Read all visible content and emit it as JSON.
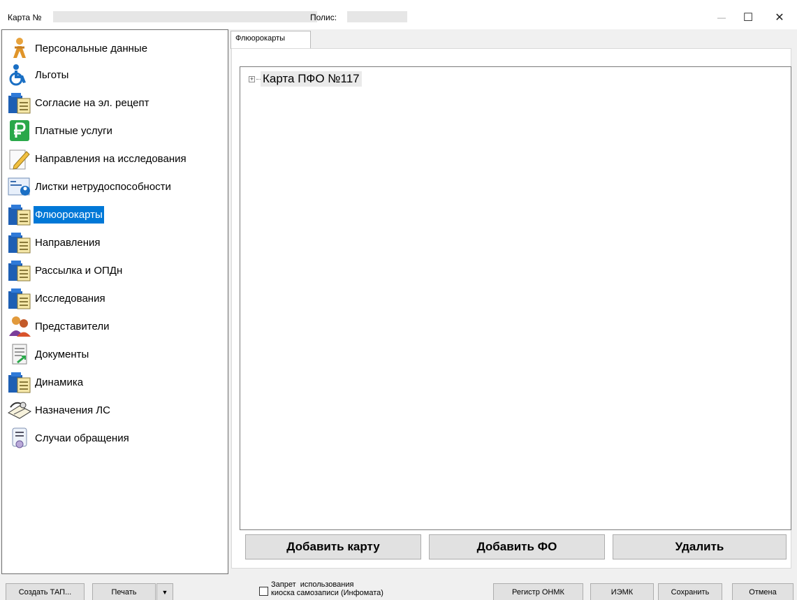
{
  "title": {
    "card_label": "Карта №",
    "policy_label": "Полис:"
  },
  "window_controls": {
    "minimize": "—",
    "maximize": "☐",
    "close": "✕"
  },
  "sidebar": {
    "items": [
      {
        "label": "Персональные данные",
        "icon": "person-icon"
      },
      {
        "label": "Льготы",
        "icon": "wheelchair-icon"
      },
      {
        "label": "Согласие на эл. рецепт",
        "icon": "folder-icon"
      },
      {
        "label": "Платные услуги",
        "icon": "ruble-icon"
      },
      {
        "label": "Направления на исследования",
        "icon": "pencil-icon"
      },
      {
        "label": "Листки нетрудоспособности",
        "icon": "sick-leave-icon"
      },
      {
        "label": "Флюорокарты",
        "icon": "folder-icon",
        "selected": true
      },
      {
        "label": "Направления",
        "icon": "folder-icon"
      },
      {
        "label": "Рассылка и ОПДн",
        "icon": "folder-icon"
      },
      {
        "label": "Исследования",
        "icon": "folder-icon"
      },
      {
        "label": "Представители",
        "icon": "people-icon"
      },
      {
        "label": "Документы",
        "icon": "document-icon"
      },
      {
        "label": "Динамика",
        "icon": "folder-icon"
      },
      {
        "label": "Назначения ЛС",
        "icon": "prescription-icon"
      },
      {
        "label": "Случаи обращения",
        "icon": "case-icon"
      }
    ]
  },
  "tabs": [
    {
      "label": "Флюорокарты"
    }
  ],
  "tree": {
    "expander": "+",
    "nodes": [
      {
        "label": "Карта ПФО №117"
      }
    ]
  },
  "actions": {
    "add_card": "Добавить карту",
    "add_fo": "Добавить ФО",
    "delete": "Удалить"
  },
  "footer": {
    "create_tap": "Создать ТАП...",
    "print": "Печать",
    "print_arrow": "▼",
    "kiosk_line1": "Запрет  использования",
    "kiosk_line2": "киоска самозаписи (Инфомата)",
    "register_onmk": "Регистр ОНМК",
    "iemk": "ИЭМК",
    "save": "Сохранить",
    "cancel": "Отмена"
  }
}
